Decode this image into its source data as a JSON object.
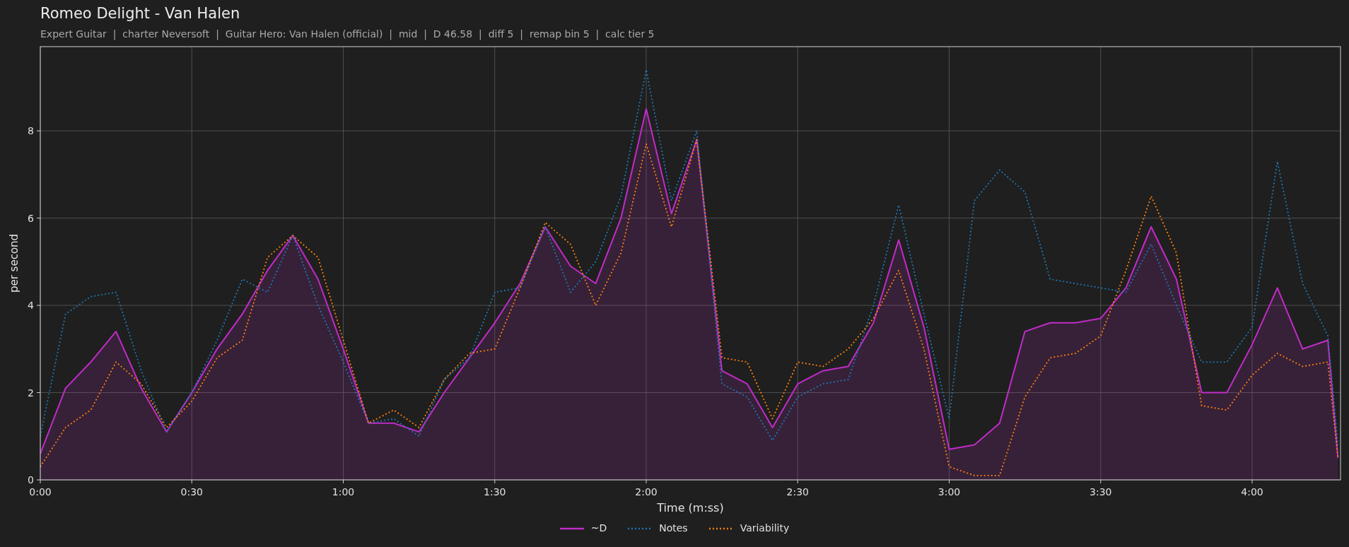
{
  "subtitle": "Expert Guitar  |  charter Neversoft  |  Guitar Hero: Van Halen (official)  |  mid  |  D 46.58  |  diff 5  |  remap bin 5  |  calc tier 5",
  "chart_data": {
    "type": "line",
    "title": "Romeo Delight - Van Halen",
    "xlabel": "Time (m:ss)",
    "ylabel": "per second",
    "x": [
      0,
      5,
      10,
      15,
      20,
      25,
      30,
      35,
      40,
      45,
      50,
      55,
      60,
      65,
      70,
      75,
      80,
      85,
      90,
      95,
      100,
      105,
      110,
      115,
      120,
      125,
      130,
      135,
      140,
      145,
      150,
      155,
      160,
      165,
      170,
      175,
      180,
      185,
      190,
      195,
      200,
      205,
      210,
      215,
      220,
      225,
      230,
      235,
      240,
      245,
      250,
      255,
      257
    ],
    "series": [
      {
        "name": "~D",
        "type": "area",
        "color": "#c02cc8",
        "values": [
          0.6,
          2.1,
          2.7,
          3.4,
          2.1,
          1.1,
          2.0,
          3.0,
          3.8,
          4.8,
          5.6,
          4.6,
          3.0,
          1.3,
          1.3,
          1.1,
          2.0,
          2.8,
          3.6,
          4.5,
          5.8,
          4.9,
          4.5,
          6.0,
          8.5,
          6.1,
          7.8,
          2.5,
          2.2,
          1.2,
          2.2,
          2.5,
          2.6,
          3.6,
          5.5,
          3.5,
          0.7,
          0.8,
          1.3,
          3.4,
          3.6,
          3.6,
          3.7,
          4.4,
          5.8,
          4.6,
          2.0,
          2.0,
          3.1,
          4.4,
          3.0,
          3.2,
          0.5
        ]
      },
      {
        "name": "Notes",
        "line_style": "dotted",
        "color": "#1f77b4",
        "values": [
          1.0,
          3.8,
          4.2,
          4.3,
          2.5,
          1.1,
          2.0,
          3.2,
          4.6,
          4.3,
          5.6,
          4.0,
          2.7,
          1.3,
          1.4,
          1.0,
          2.3,
          2.8,
          4.3,
          4.4,
          5.8,
          4.3,
          5.0,
          6.5,
          9.4,
          6.4,
          8.0,
          2.2,
          1.9,
          0.9,
          1.9,
          2.2,
          2.3,
          4.0,
          6.3,
          3.8,
          1.4,
          6.4,
          7.1,
          6.6,
          4.6,
          4.5,
          4.4,
          4.3,
          5.4,
          4.0,
          2.7,
          2.7,
          3.5,
          7.3,
          4.5,
          3.3,
          0.8
        ]
      },
      {
        "name": "Variability",
        "line_style": "dotted",
        "color": "#ff7f0e",
        "values": [
          0.3,
          1.2,
          1.6,
          2.7,
          2.2,
          1.2,
          1.8,
          2.8,
          3.2,
          5.1,
          5.6,
          5.1,
          3.2,
          1.3,
          1.6,
          1.2,
          2.3,
          2.9,
          3.0,
          4.4,
          5.9,
          5.4,
          4.0,
          5.2,
          7.7,
          5.8,
          7.8,
          2.8,
          2.7,
          1.4,
          2.7,
          2.6,
          3.0,
          3.7,
          4.8,
          3.0,
          0.3,
          0.1,
          0.1,
          1.9,
          2.8,
          2.9,
          3.3,
          4.8,
          6.5,
          5.2,
          1.7,
          1.6,
          2.4,
          2.9,
          2.6,
          2.7,
          0.5
        ]
      }
    ],
    "xlim": [
      0,
      257.5
    ],
    "ylim": [
      0,
      9.93
    ],
    "xticks": [
      {
        "value": 0,
        "label": "0:00"
      },
      {
        "value": 30,
        "label": "0:30"
      },
      {
        "value": 60,
        "label": "1:00"
      },
      {
        "value": 90,
        "label": "1:30"
      },
      {
        "value": 120,
        "label": "2:00"
      },
      {
        "value": 150,
        "label": "2:30"
      },
      {
        "value": 180,
        "label": "3:00"
      },
      {
        "value": 210,
        "label": "3:30"
      },
      {
        "value": 240,
        "label": "4:00"
      }
    ],
    "yticks": [
      0,
      2,
      4,
      6,
      8
    ],
    "grid": true
  }
}
